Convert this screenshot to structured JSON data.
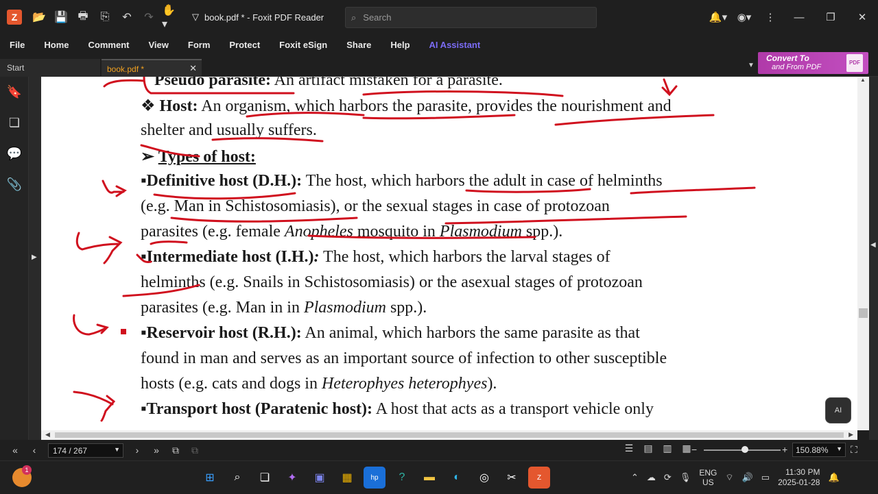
{
  "window": {
    "title": "book.pdf * - Foxit PDF Reader",
    "search_placeholder": "Search"
  },
  "menu": [
    "File",
    "Home",
    "Comment",
    "View",
    "Form",
    "Protect",
    "Foxit eSign",
    "Share",
    "Help",
    "AI Assistant"
  ],
  "tabs": {
    "start": "Start",
    "active": "book.pdf *"
  },
  "banner": {
    "line1": "Convert To",
    "line2": "and From PDF",
    "badge": "PDF"
  },
  "document": {
    "lines": {
      "l1_head": "Pseudo parasite:",
      "l1_text": " An artifact mistaken for a parasite.",
      "l2_bullet": "❖  ",
      "l2_head": "Host:",
      "l2_text": " An organism, which harbors the parasite, provides the nourishment and",
      "l3_text": "shelter and usually suffers.",
      "l4_arrow": "➢ ",
      "l4_head": "Types of host:",
      "l5_bullet": "▪",
      "l5_head": "Definitive host (D.H.):",
      "l5_text": " The host, which harbors the adult in case of helminths",
      "l6_text": "(e.g. Man in Schistosomiasis), or the sexual stages in case of protozoan",
      "l7_a": "parasites (e.g. female ",
      "l7_i1": "Anopheles",
      "l7_b": " mosquito in ",
      "l7_i2": "Plasmodium",
      "l7_c": " spp.).",
      "l8_bullet": "▪",
      "l8_head": "Intermediate host (I.H.)",
      "l8_colon": ":",
      "l8_text": " The host, which harbors the larval stages of",
      "l9_text": "helminths (e.g. Snails in Schistosomiasis) or the asexual stages of protozoan",
      "l10_a": "parasites (e.g. Man in in ",
      "l10_i": "Plasmodium",
      "l10_b": " spp.).",
      "l11_bullet": "▪",
      "l11_head": "Reservoir host (R.H.):",
      "l11_text": " An animal, which harbors the same parasite as that",
      "l12_text": "found in man and serves as an important source of infection to other susceptible",
      "l13_a": "hosts (e.g. cats and dogs in ",
      "l13_i": "Heterophyes heterophyes",
      "l13_b": ").",
      "l14_bullet": "▪",
      "l14_head": "Transport host (Paratenic host):",
      "l14_text": " A host that acts as a transport vehicle only"
    }
  },
  "status": {
    "page_indicator": "174 / 267",
    "zoom": "150.88%",
    "zoom_level_fraction": 0.54
  },
  "ai_fab": "AI",
  "taskbar": {
    "badge_count": "1",
    "lang_line1": "ENG",
    "lang_line2": "US",
    "time": "11:30 PM",
    "date": "2025-01-28"
  },
  "colors": {
    "ink": "#d0101e",
    "accent": "#7b6cf6",
    "tab_active_text": "#f0a020",
    "banner": "#b03aa9"
  }
}
